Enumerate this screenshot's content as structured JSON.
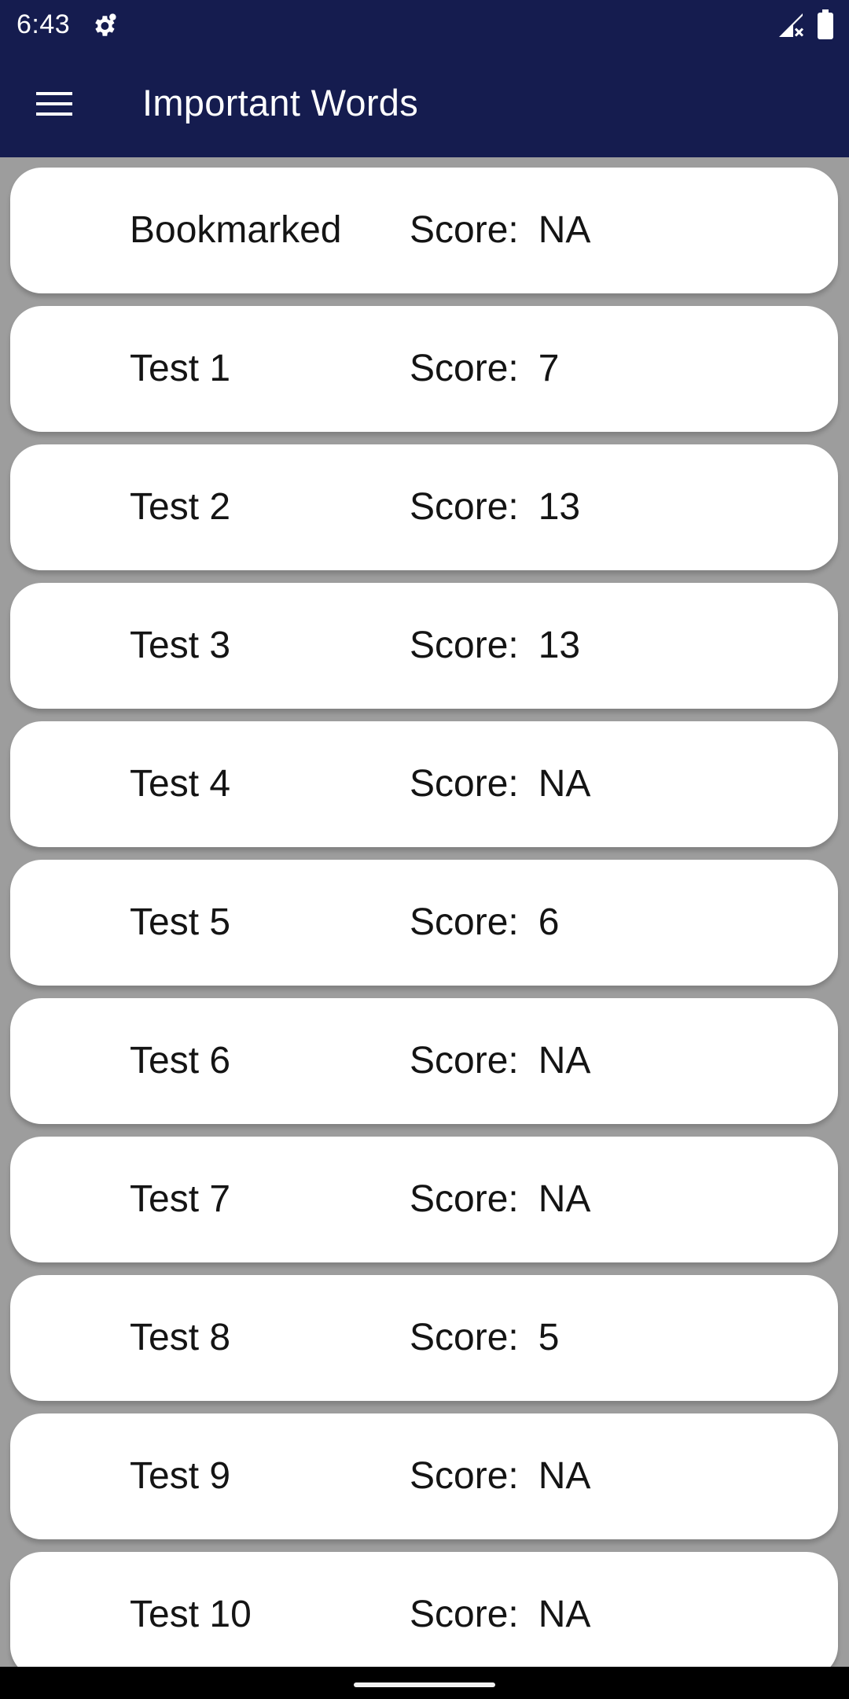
{
  "status_bar": {
    "time": "6:43",
    "icons": [
      "settings-gear-icon",
      "signal-no-service-icon",
      "battery-icon"
    ]
  },
  "app_bar": {
    "menu_icon": "hamburger-menu-icon",
    "title": "Important Words",
    "background": "#151c4f"
  },
  "tests": [
    {
      "name": "Bookmarked",
      "score_label": "Score:",
      "score": "NA"
    },
    {
      "name": "Test 1",
      "score_label": "Score:",
      "score": "7"
    },
    {
      "name": "Test 2",
      "score_label": "Score:",
      "score": "13"
    },
    {
      "name": "Test 3",
      "score_label": "Score:",
      "score": "13"
    },
    {
      "name": "Test 4",
      "score_label": "Score:",
      "score": "NA"
    },
    {
      "name": "Test 5",
      "score_label": "Score:",
      "score": "6"
    },
    {
      "name": "Test 6",
      "score_label": "Score:",
      "score": "NA"
    },
    {
      "name": "Test 7",
      "score_label": "Score:",
      "score": "NA"
    },
    {
      "name": "Test 8",
      "score_label": "Score:",
      "score": "5"
    },
    {
      "name": "Test 9",
      "score_label": "Score:",
      "score": "NA"
    },
    {
      "name": "Test 10",
      "score_label": "Score:",
      "score": "NA"
    }
  ],
  "nav_bar": {
    "handle": "gesture-handle"
  }
}
